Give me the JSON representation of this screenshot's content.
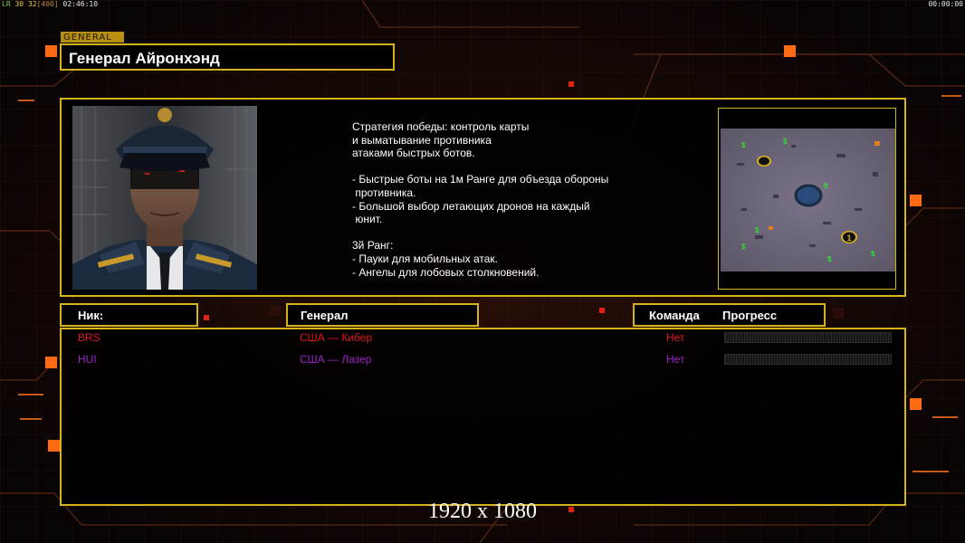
{
  "hud": {
    "left_lr": "LR",
    "left_fps": "30",
    "left_fps2": "32",
    "left_limit": "[400]",
    "left_time": "02:46:10",
    "right_time": "00:00:00"
  },
  "general": {
    "tag": "GENERAL",
    "name": "Генерал Айронхэнд"
  },
  "description": "Стратегия победы: контроль карты\nи выматывание противника\nатаками быстрых ботов.\n\n- Быстрые боты на 1м Ранге для объезда обороны\n противника.\n- Большой выбор летающих дронов на каждый\n юнит.\n\n3й Ранг:\n- Пауки для мобильных атак.\n- Ангелы для лобовых столкновений.",
  "minimap": {
    "start_label": "1"
  },
  "headers": {
    "nick": "Ник:",
    "general": "Генерал",
    "team": "Команда",
    "progress": "Прогресс"
  },
  "players": [
    {
      "nick": "BRS",
      "general": "США — Кибер",
      "team": "Нет",
      "color": "#e01818",
      "progress": 0
    },
    {
      "nick": "HUI",
      "general": "США — Лазер",
      "team": "Нет",
      "color": "#9a22c8",
      "progress": 0
    }
  ],
  "resolution": "1920 x 1080",
  "colors": {
    "frame": "#d6b21c",
    "accent": "#ff7a1a"
  }
}
